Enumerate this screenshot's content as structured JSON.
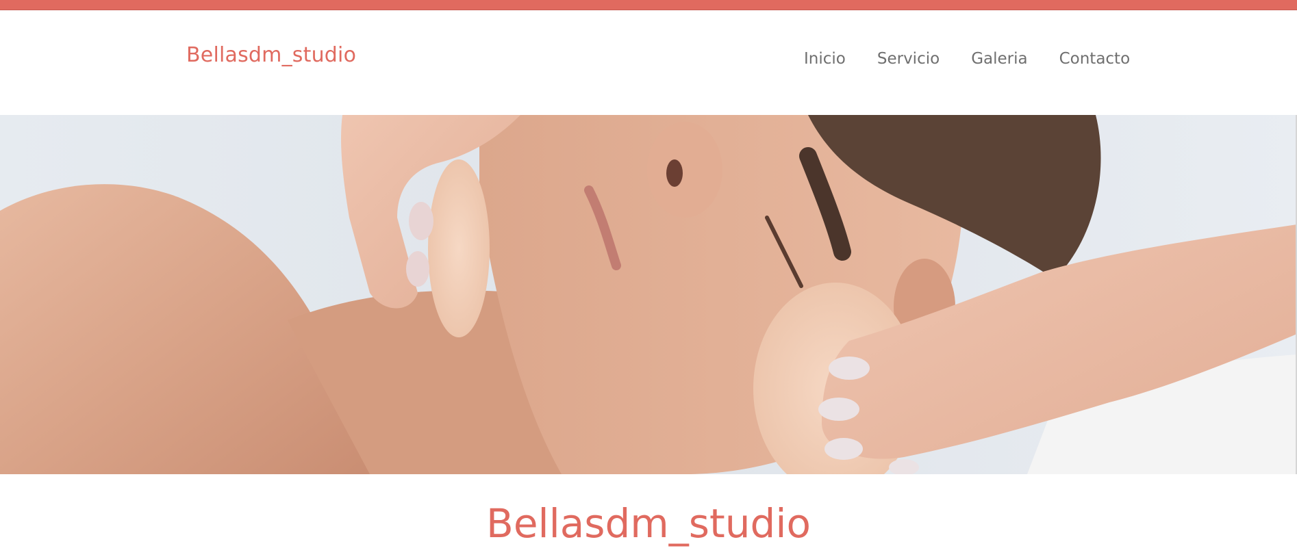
{
  "header": {
    "brand": "Bellasdm_studio",
    "nav": [
      {
        "label": "Inicio"
      },
      {
        "label": "Servicio"
      },
      {
        "label": "Galeria"
      },
      {
        "label": "Contacto"
      }
    ]
  },
  "main": {
    "heading": "Bellasdm_studio"
  },
  "colors": {
    "accent": "#e06a5f",
    "nav_text": "#6f6f6f",
    "background": "#ffffff"
  },
  "hero": {
    "image_subject": "facial-treatment-photo"
  }
}
